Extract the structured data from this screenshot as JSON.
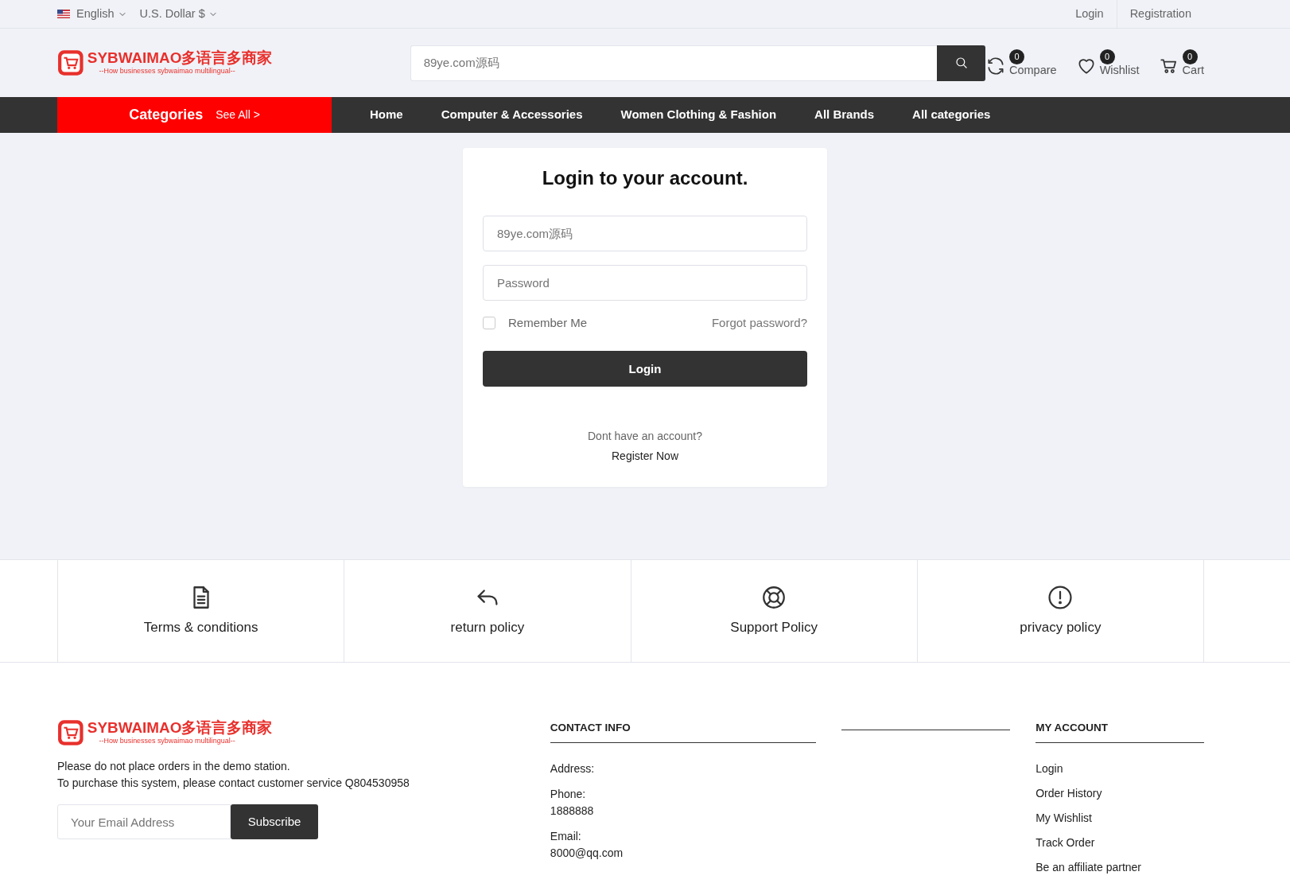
{
  "top_bar": {
    "language": "English",
    "currency": "U.S. Dollar $",
    "links": [
      "Login",
      "Registration"
    ]
  },
  "header": {
    "logo": {
      "title": "SYBWAIMAO多语言多商家",
      "tagline": "--How businesses sybwaimao multilingual--"
    },
    "search": {
      "placeholder": "89ye.com源码"
    },
    "counters": [
      {
        "kind": "compare",
        "label": "Compare",
        "count": "0"
      },
      {
        "kind": "wishlist",
        "label": "Wishlist",
        "count": "0"
      },
      {
        "kind": "cart",
        "label": "Cart",
        "count": "0"
      }
    ]
  },
  "nav": {
    "categories": {
      "title": "Categories",
      "see_all": "See All >"
    },
    "links": [
      "Home",
      "Computer & Accessories",
      "Women Clothing & Fashion",
      "All Brands",
      "All categories"
    ]
  },
  "login_card": {
    "title": "Login to your account.",
    "fields": [
      {
        "placeholder": "89ye.com源码"
      },
      {
        "placeholder": "Password"
      }
    ],
    "remember": {
      "label": "Remember Me",
      "checked": false
    },
    "forgot": "Forgot password?",
    "button": "Login",
    "prompt": "Dont have an account?",
    "register_link": "Register Now"
  },
  "policies": [
    {
      "kind": "document",
      "label": "Terms & conditions"
    },
    {
      "kind": "return",
      "label": "return policy"
    },
    {
      "kind": "support",
      "label": "Support Policy"
    },
    {
      "kind": "info",
      "label": "privacy policy"
    }
  ],
  "footer": {
    "logo": {
      "title": "SYBWAIMAO多语言多商家",
      "tagline": "--How businesses sybwaimao multilingual--"
    },
    "notice": [
      "Please do not place orders in the demo station.",
      "To purchase this system, please contact customer service Q804530958"
    ],
    "subscribe": {
      "placeholder": "Your Email Address",
      "button": "Subscribe"
    },
    "contact": {
      "title": "CONTACT INFO",
      "items": [
        {
          "label": "Address:"
        },
        {
          "label": "Phone:",
          "value": "1888888"
        },
        {
          "label": "Email:",
          "value": "8000@qq.com"
        }
      ]
    },
    "my_account": {
      "title": "MY ACCOUNT",
      "links": [
        "Login",
        "Order History",
        "My Wishlist",
        "Track Order",
        "Be an affiliate partner"
      ]
    }
  }
}
